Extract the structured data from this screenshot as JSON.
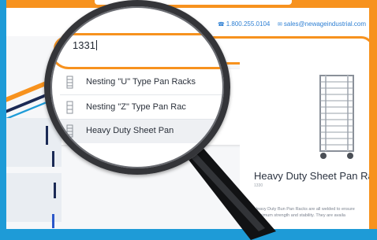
{
  "header": {
    "phone": "1.800.255.0104",
    "email": "sales@newageindustrial.com"
  },
  "search": {
    "query": "1331"
  },
  "suggestions": [
    {
      "label": "Nesting \"U\" Type Pan Racks"
    },
    {
      "label": "Nesting \"Z\" Type Pan Rac"
    },
    {
      "label": "Heavy Duty Sheet Pan"
    }
  ],
  "product": {
    "title": "Heavy Duty Sheet Pan Racks",
    "sku": "1330",
    "description": "Heavy Duty Bun Pan Racks are all welded to ensure maximum strength and stability. They are availa"
  },
  "colors": {
    "accent_orange": "#f7921e",
    "accent_blue": "#1e9bd7",
    "navy": "#1b2a55"
  }
}
